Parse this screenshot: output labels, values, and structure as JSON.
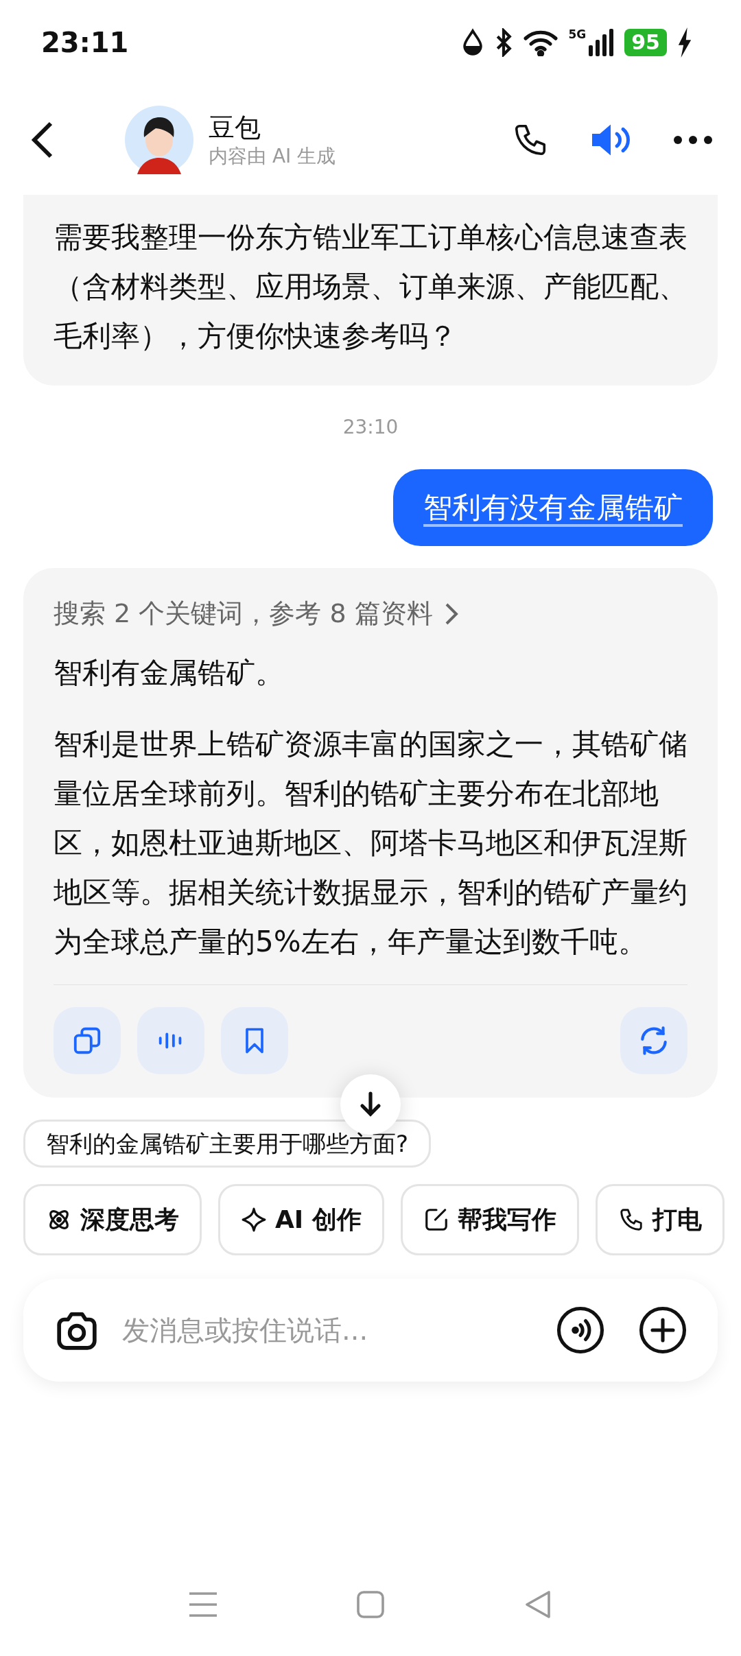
{
  "status_bar": {
    "time": "23:11",
    "battery": "95",
    "network": "5G"
  },
  "header": {
    "title": "豆包",
    "subtitle": "内容由 AI 生成"
  },
  "messages": [
    {
      "kind": "bot",
      "text": "需要我整理一份东方锆业军工订单核心信息速查表（含材料类型、应用场景、订单来源、产能匹配、毛利率），方便你快速参考吗？"
    },
    {
      "kind": "time",
      "text": "23:10"
    },
    {
      "kind": "user",
      "text": "智利有没有金属锆矿"
    },
    {
      "kind": "answer",
      "sources": "搜索 2 个关键词，参考 8 篇资料",
      "paragraphs": [
        "智利有金属锆矿。",
        "智利是世界上锆矿资源丰富的国家之一，其锆矿储量位居全球前列。智利的锆矿主要分布在北部地区，如恩杜亚迪斯地区、阿塔卡马地区和伊瓦涅斯地区等。据相关统计数据显示，智利的锆矿产量约为全球总产量的5%左右，年产量达到数千吨。"
      ]
    }
  ],
  "suggestion": "智利的金属锆矿主要用于哪些方面?",
  "chips": [
    {
      "kind": "think",
      "label": "深度思考"
    },
    {
      "kind": "spark",
      "label": "AI 创作"
    },
    {
      "kind": "write",
      "label": "帮我写作"
    },
    {
      "kind": "phone",
      "label": "打电"
    }
  ],
  "input": {
    "placeholder": "发消息或按住说话..."
  }
}
